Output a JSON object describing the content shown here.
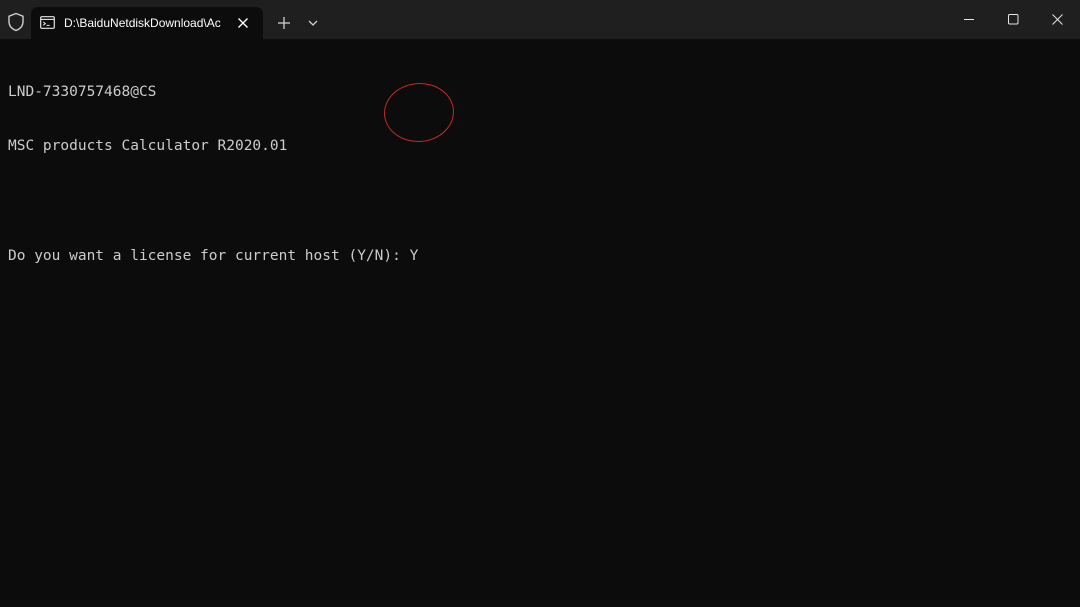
{
  "window": {
    "tab_title": "D:\\BaiduNetdiskDownload\\Ac",
    "icons": {
      "shield": "shield-icon",
      "tab": "terminal-icon",
      "tab_close": "close-icon",
      "new_tab": "plus-icon",
      "dropdown": "chevron-down-icon",
      "minimize": "minimize-icon",
      "maximize": "maximize-icon",
      "close": "close-icon"
    }
  },
  "console": {
    "lines": [
      "LND-7330757468@CS",
      "MSC products Calculator R2020.01",
      "",
      "Do you want a license for current host (Y/N): Y"
    ]
  },
  "colors": {
    "background": "#0c0c0c",
    "titlebar": "#1f1f1f",
    "text": "#cccccc",
    "annotation": "#c62828"
  }
}
